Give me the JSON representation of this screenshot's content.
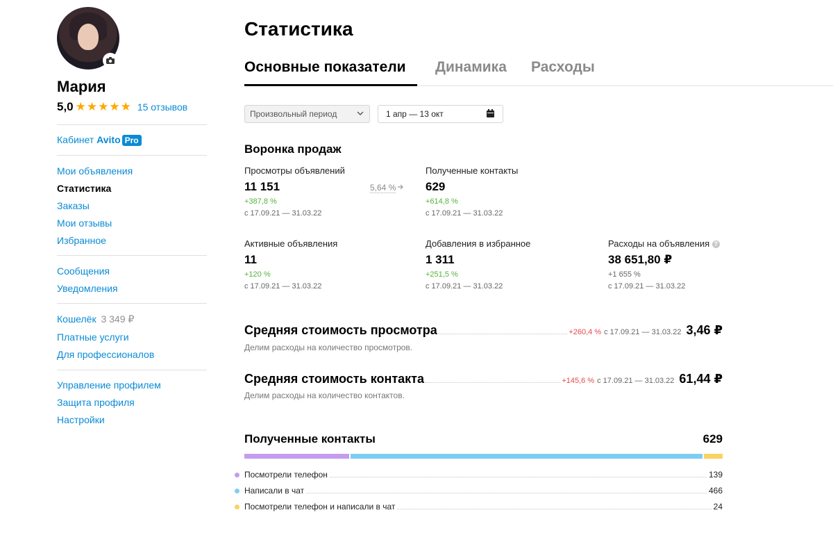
{
  "profile": {
    "name": "Мария",
    "rating": "5,0",
    "stars": "★★★★★",
    "reviews": "15 отзывов"
  },
  "sidebar": {
    "cabinet_prefix": "Кабинет",
    "cabinet_brand": "Avito",
    "cabinet_badge": "Pro",
    "group1": [
      "Мои объявления",
      "Статистика",
      "Заказы",
      "Мои отзывы",
      "Избранное"
    ],
    "group2": [
      "Сообщения",
      "Уведомления"
    ],
    "wallet_label": "Кошелёк",
    "wallet_amount": "3 349 ₽",
    "group3": [
      "Платные услуги",
      "Для профессионалов"
    ],
    "group4": [
      "Управление профилем",
      "Защита профиля",
      "Настройки"
    ]
  },
  "page": {
    "title": "Статистика",
    "tabs": [
      "Основные показатели",
      "Динамика",
      "Расходы"
    ],
    "active_tab": "Основные показатели"
  },
  "filters": {
    "period_select": "Произвольный период",
    "date_range": "1 апр — 13 окт"
  },
  "funnel": {
    "title": "Воронка продаж",
    "conversion": "5,64 %",
    "metrics": [
      {
        "label": "Просмотры объявлений",
        "value": "11 151",
        "change": "+387,8 %",
        "period": "с 17.09.21 — 31.03.22"
      },
      {
        "label": "Полученные контакты",
        "value": "629",
        "change": "+614,8 %",
        "period": "с 17.09.21 — 31.03.22"
      },
      {
        "label": "Активные объявления",
        "value": "11",
        "change": "+120 %",
        "period": "с 17.09.21 — 31.03.22"
      },
      {
        "label": "Добавления в избранное",
        "value": "1 311",
        "change": "+251,5 %",
        "period": "с 17.09.21 — 31.03.22"
      },
      {
        "label": "Расходы на объявления",
        "value": "38 651,80 ₽",
        "change": "+1 655 %",
        "period": "с 17.09.21 — 31.03.22",
        "help": "?"
      }
    ]
  },
  "costs": [
    {
      "title": "Средняя стоимость просмотра",
      "desc": "Делим расходы на количество просмотров.",
      "change": "+260,4 %",
      "period": "с 17.09.21 — 31.03.22",
      "value": "3,46 ₽"
    },
    {
      "title": "Средняя стоимость контакта",
      "desc": "Делим расходы на количество контактов.",
      "change": "+145,6 %",
      "period": "с 17.09.21 — 31.03.22",
      "value": "61,44 ₽"
    }
  ],
  "contacts": {
    "title": "Полученные контакты",
    "total": "629",
    "items": [
      {
        "label": "Посмотрели телефон",
        "value": 139,
        "color": "#c59cf0"
      },
      {
        "label": "Написали в чат",
        "value": 466,
        "color": "#7dcdf3"
      },
      {
        "label": "Посмотрели телефон и написали в чат",
        "value": 24,
        "color": "#fbd160"
      }
    ]
  },
  "colors": {
    "link": "#0a8bd5",
    "positive": "#55b33a",
    "negative": "#e8484b",
    "star": "#ffa800"
  }
}
